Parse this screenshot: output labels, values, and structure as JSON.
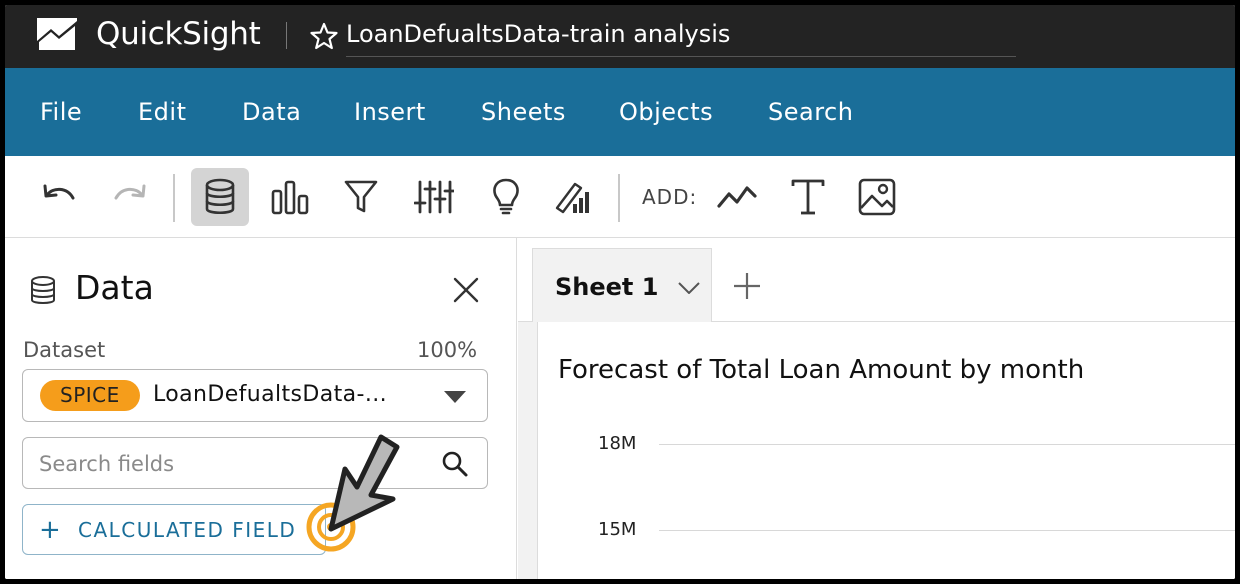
{
  "header": {
    "app_name": "QuickSight",
    "analysis_name": "LoanDefualtsData-train analysis"
  },
  "menu": {
    "items": [
      "File",
      "Edit",
      "Data",
      "Insert",
      "Sheets",
      "Objects",
      "Search"
    ]
  },
  "toolbar": {
    "add_label": "ADD:",
    "icons": [
      "undo-icon",
      "redo-icon",
      "database-icon",
      "visualize-icon",
      "filter-icon",
      "parameters-icon",
      "insights-icon",
      "themes-icon",
      "add-line-chart-icon",
      "add-text-icon",
      "add-image-icon"
    ]
  },
  "data_pane": {
    "title": "Data",
    "dataset_label": "Dataset",
    "dataset_percent": "100%",
    "spice_badge": "SPICE",
    "dataset_name": "LoanDefualtsData-...",
    "search_placeholder": "Search fields",
    "search_value": "",
    "calculated_field_label": "CALCULATED FIELD"
  },
  "sheets": {
    "tabs": [
      {
        "label": "Sheet 1"
      }
    ],
    "add_label": "+"
  },
  "visual": {
    "title": "Forecast of Total Loan Amount by month",
    "y_ticks": [
      "18M",
      "15M"
    ]
  },
  "colors": {
    "header_bg": "#232323",
    "menu_bg": "#1a6e99",
    "spice_badge": "#f59d1b",
    "accent_text": "#1a6e99",
    "click_indicator": "#f5a623"
  }
}
